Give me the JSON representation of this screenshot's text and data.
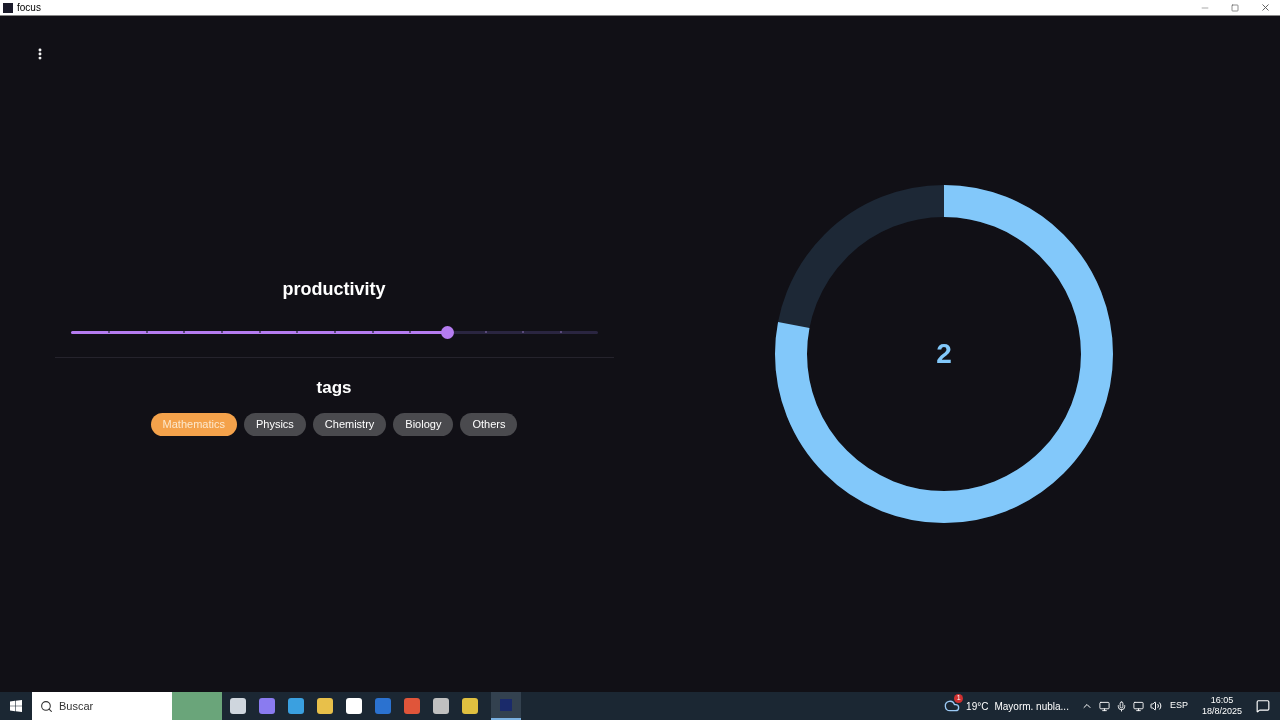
{
  "window": {
    "title": "focus"
  },
  "productivity": {
    "title": "productivity",
    "level": 0.714
  },
  "tags": {
    "title": "tags",
    "items": [
      {
        "label": "Mathematics",
        "selected": true
      },
      {
        "label": "Physics",
        "selected": false
      },
      {
        "label": "Chemistry",
        "selected": false
      },
      {
        "label": "Biology",
        "selected": false
      },
      {
        "label": "Others",
        "selected": false
      }
    ]
  },
  "progress_ring": {
    "value": "2",
    "level": 0.78
  },
  "taskbar": {
    "search": {
      "placeholder": "Buscar"
    },
    "weather": {
      "badge": "1",
      "temperature": "19°C",
      "condition": "Mayorm. nubla..."
    },
    "language": "ESP",
    "time": "16:05",
    "date": "18/8/2025"
  }
}
